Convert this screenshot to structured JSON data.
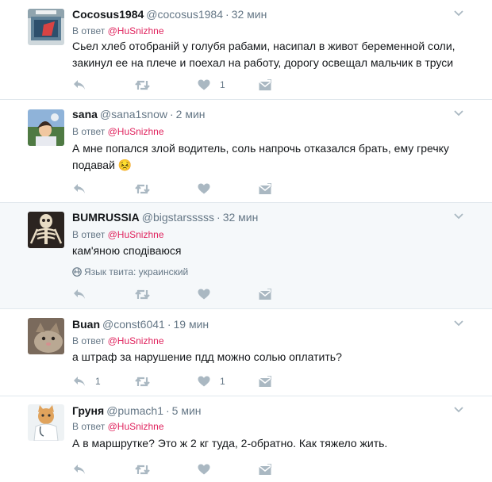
{
  "tweets": [
    {
      "fullname": "Cocosus1984",
      "handle": "@cocosus1984",
      "separator": "·",
      "time": "32 мин",
      "reply_prefix": "В ответ",
      "reply_mention": "@HuSnizhne",
      "text": "Сьел хлеб отобраній у голубя рабами, насипал в живот беременной соли, закинул ее на плече и поехал на работу, дорогу освещал мальчик в труси",
      "reply_count": "",
      "like_count": "1",
      "avatar_icon": "cocosus-avatar-icon"
    },
    {
      "fullname": "sana",
      "handle": "@sana1snow",
      "separator": "·",
      "time": "2 мин",
      "reply_prefix": "В ответ",
      "reply_mention": "@HuSnizhne",
      "text": "А мне попался злой водитель, соль напрочь отказался брать, ему гречку подавай 😣",
      "reply_count": "",
      "like_count": "",
      "avatar_icon": "sana-avatar-icon"
    },
    {
      "fullname": "BUMRUSSIA",
      "handle": "@bigstarsssss",
      "separator": "·",
      "time": "32 мин",
      "reply_prefix": "В ответ",
      "reply_mention": "@HuSnizhne",
      "text": "кам'яною сподіваюся",
      "lang_label": "Язык твита: украинский",
      "reply_count": "",
      "like_count": "",
      "avatar_icon": "skeleton-avatar-icon"
    },
    {
      "fullname": "Buan",
      "handle": "@const6041",
      "separator": "·",
      "time": "19 мин",
      "reply_prefix": "В ответ",
      "reply_mention": "@HuSnizhne",
      "text": "а штраф за нарушение пдд можно солью оплатить?",
      "reply_count": "1",
      "like_count": "1",
      "avatar_icon": "cat-avatar-icon"
    },
    {
      "fullname": "Груня",
      "handle": "@pumach1",
      "separator": "·",
      "time": "5 мин",
      "reply_prefix": "В ответ",
      "reply_mention": "@HuSnizhne",
      "text": "А в маршрутке? Это ж 2 кг туда, 2-обратно. Как тяжело жить.",
      "reply_count": "",
      "like_count": "",
      "avatar_icon": "doctor-cat-avatar-icon"
    }
  ],
  "colors": {
    "mention": "#e0245e",
    "secondary_text": "#657786",
    "icon": "#aab8c2",
    "highlight_bg": "#f5f8fa",
    "divider": "#e1e8ed"
  }
}
